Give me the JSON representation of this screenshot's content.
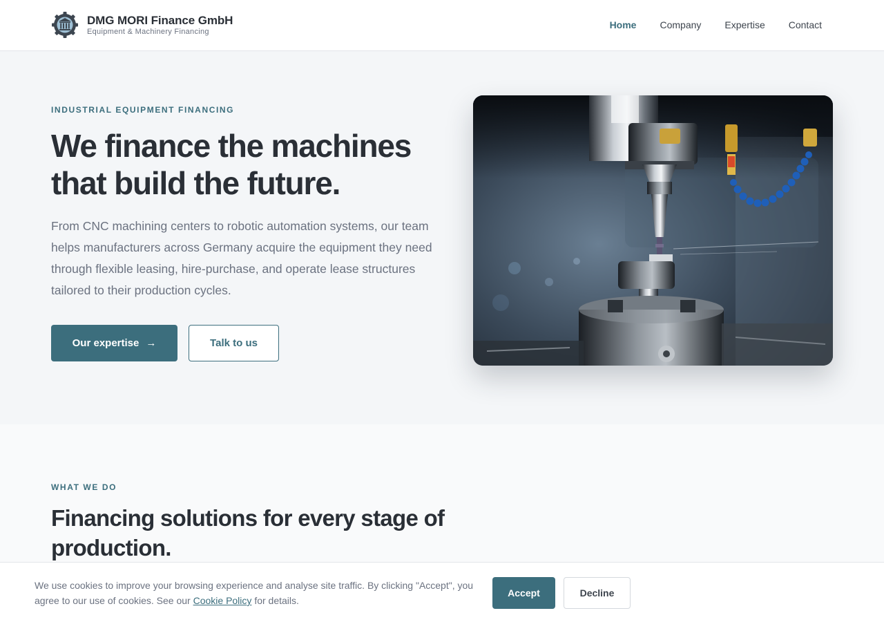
{
  "header": {
    "brand_name": "DMG MORI Finance GmbH",
    "brand_tagline": "Equipment & Machinery Financing",
    "logo_icon": "gear-pillar-icon",
    "nav": [
      {
        "label": "Home",
        "active": true
      },
      {
        "label": "Company",
        "active": false
      },
      {
        "label": "Expertise",
        "active": false
      },
      {
        "label": "Contact",
        "active": false
      }
    ]
  },
  "hero": {
    "eyebrow": "INDUSTRIAL EQUIPMENT FINANCING",
    "title": "We finance the machines that build the future.",
    "text": "From CNC machining centers to robotic automation systems, our team helps manufacturers across Germany acquire the equipment they need through flexible leasing, hire-purchase, and operate lease structures tailored to their production cycles.",
    "primary_button": "Our expertise",
    "primary_button_icon": "arrow-right-icon",
    "secondary_button": "Talk to us",
    "image_subject": "cnc-milling-machine-photo"
  },
  "section": {
    "eyebrow": "WHAT WE DO",
    "title": "Financing solutions for every stage of production."
  },
  "cookie": {
    "text_before": "We use cookies to improve your browsing experience and analyse site traffic. By clicking \"Accept\", you agree to our use of cookies. See our",
    "link": "Cookie Policy",
    "text_after": "for details.",
    "accept": "Accept",
    "decline": "Decline"
  },
  "colors": {
    "accent": "#3c6e7d",
    "text_dark": "#2a2f36",
    "text_muted": "#6b7280",
    "hero_bg": "#f4f6f8"
  }
}
